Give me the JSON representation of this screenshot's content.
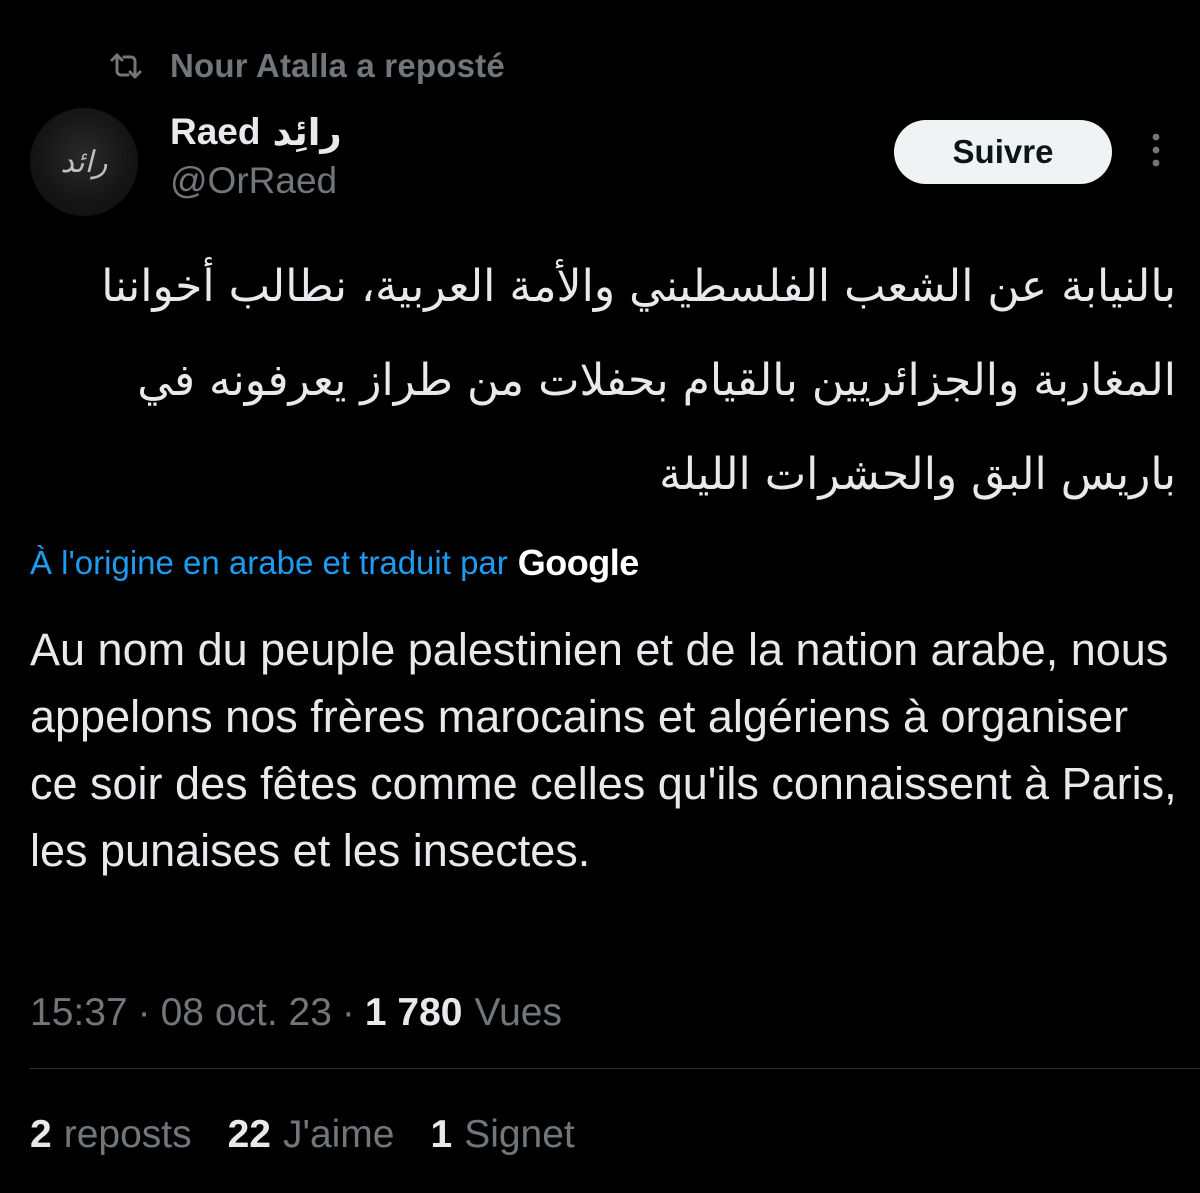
{
  "repost": {
    "icon": "repost-icon",
    "text": "Nour Atalla a reposté"
  },
  "author": {
    "name": "Raed",
    "name_ar": "رائِد",
    "handle": "@OrRaed",
    "avatar_calligraphy": "رائد"
  },
  "actions": {
    "follow_label": "Suivre",
    "more_icon": "more-vertical-icon"
  },
  "tweet": {
    "arabic_lines": [
      "بالنيابة عن الشعب الفلسطيني والأمة العربية، نطالب أخواننا",
      "المغاربة والجزائريين بالقيام بحفلات من طراز يعرفونه في",
      "باريس البق والحشرات الليلة"
    ],
    "translation_label": "À l'origine en arabe et traduit par",
    "translation_provider": "Google",
    "translated_text": "Au nom du peuple palestinien et de la nation arabe, nous appelons nos frères marocains et algériens à organiser ce soir des fêtes comme celles qu'ils connaissent à Paris, les punaises et les insectes."
  },
  "meta": {
    "time": "15:37",
    "separator": "·",
    "date": "08 oct. 23",
    "views_count": "1 780",
    "views_label": "Vues"
  },
  "stats": {
    "reposts_count": "2",
    "reposts_label": "reposts",
    "likes_count": "22",
    "likes_label": "J'aime",
    "bookmarks_count": "1",
    "bookmarks_label": "Signet"
  },
  "colors": {
    "background": "#000000",
    "primary_text": "#e7e9ea",
    "secondary_text": "#71767b",
    "link": "#1d9bf0",
    "follow_button_bg": "#eff3f4",
    "divider": "#2f3336"
  }
}
